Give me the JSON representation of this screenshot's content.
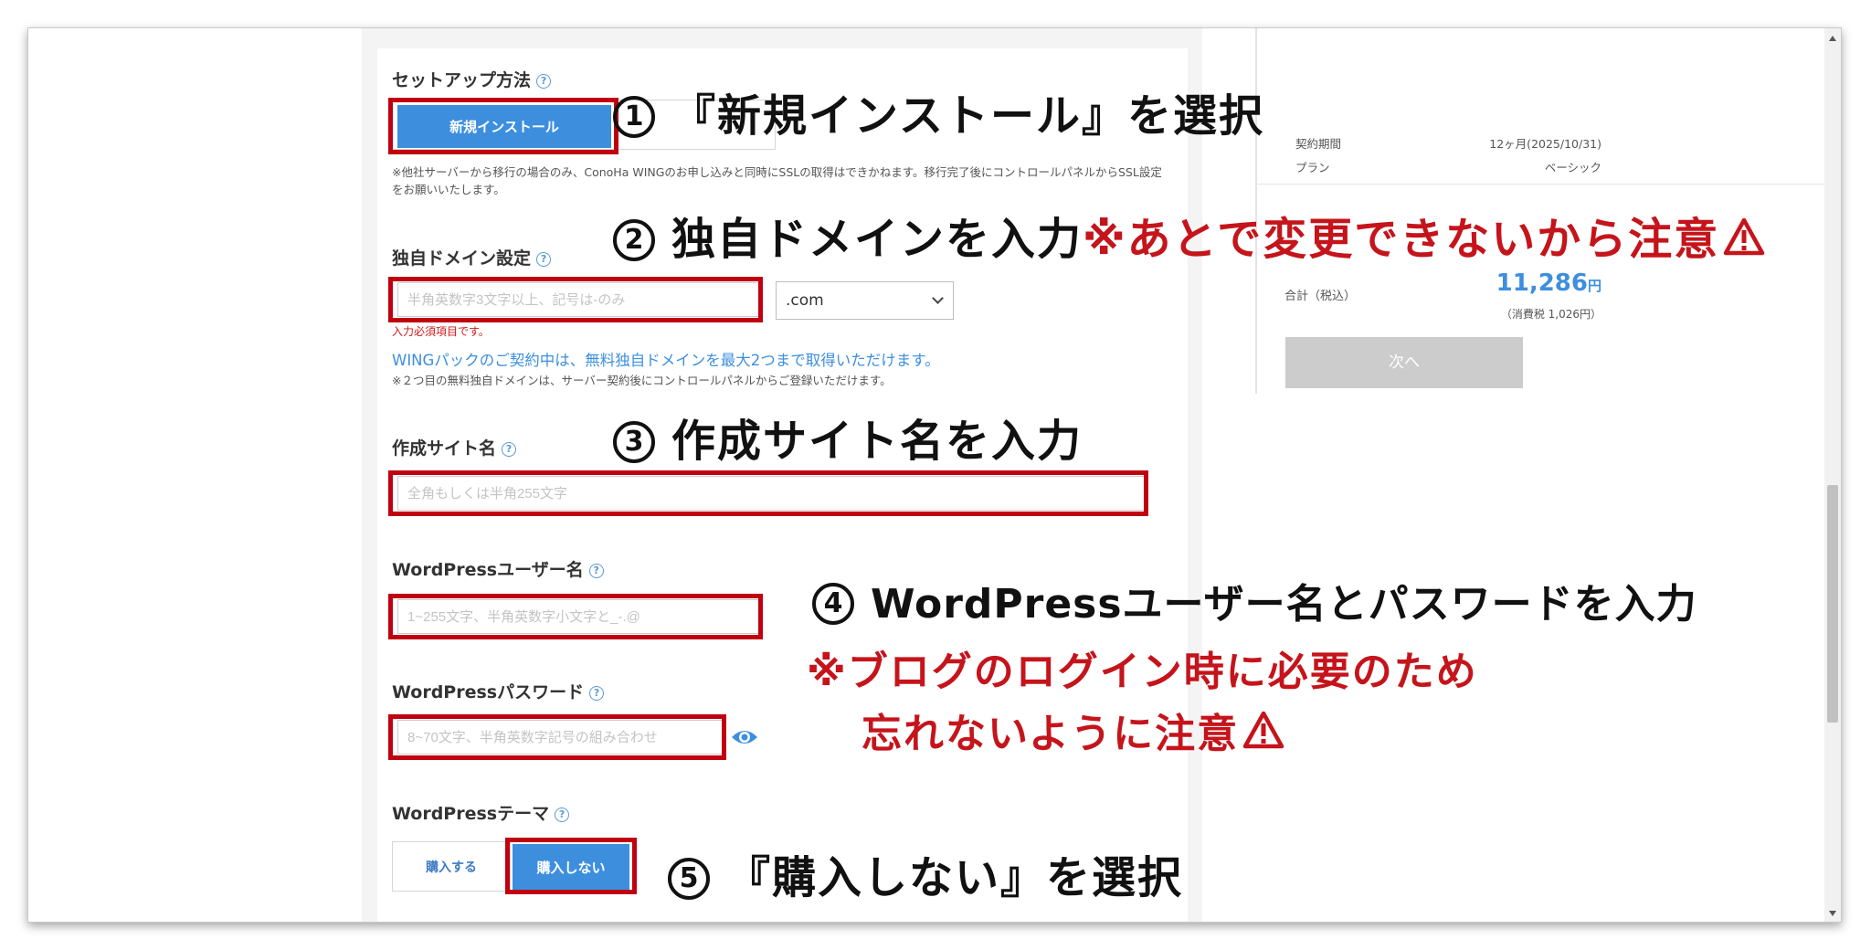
{
  "form": {
    "setup": {
      "label": "セットアップ方法",
      "help": "?",
      "new_install_button": "新規インストール",
      "note": "※他社サーバーから移行の場合のみ、ConoHa WINGのお申し込みと同時にSSLの取得はできかねます。移行完了後にコントロールパネルからSSL設定をお願いいたします。"
    },
    "domain": {
      "label": "独自ドメイン設定",
      "help": "?",
      "placeholder": "半角英数字3文字以上、記号は-のみ",
      "tld_selected": ".com",
      "required_error": "入力必須項目です。",
      "info": "WINGパックのご契約中は、無料独自ドメインを最大2つまで取得いただけます。",
      "note": "※２つ目の無料独自ドメインは、サーバー契約後にコントロールパネルからご登録いただけます。"
    },
    "site_name": {
      "label": "作成サイト名",
      "help": "?",
      "placeholder": "全角もしくは半角255文字"
    },
    "wp_user": {
      "label": "WordPressユーザー名",
      "help": "?",
      "placeholder": "1~255文字、半角英数字小文字と_-.@"
    },
    "wp_password": {
      "label": "WordPressパスワード",
      "help": "?",
      "placeholder": "8~70文字、半角英数字記号の組み合わせ"
    },
    "wp_theme": {
      "label": "WordPressテーマ",
      "help": "?",
      "buy_button": "購入する",
      "no_buy_button": "購入しない"
    }
  },
  "side": {
    "period_label": "契約期間",
    "period_value": "12ヶ月(2025/10/31)",
    "plan_label": "プラン",
    "plan_value": "ベーシック",
    "total_label": "合計（税込）",
    "total_value": "11,286",
    "total_unit": "円",
    "tax": "（消費税 1,026円）",
    "next_button": "次へ"
  },
  "annotations": {
    "a1": {
      "num": "1",
      "text": "『新規インストール』を選択"
    },
    "a2": {
      "num": "2",
      "text": "独自ドメインを入力",
      "warn": "※あとで変更できないから注意"
    },
    "a3": {
      "num": "3",
      "text": "作成サイト名を入力"
    },
    "a4": {
      "num": "4",
      "text": "WordPressユーザー名とパスワードを入力",
      "warn1": "※ブログのログイン時に必要のため",
      "warn2": "忘れないように注意"
    },
    "a5": {
      "num": "5",
      "text": "『購入しない』を選択"
    }
  },
  "colors": {
    "accent_blue": "#3d8fde",
    "highlight_red": "#c00010",
    "annotation_red": "#c5141b"
  }
}
